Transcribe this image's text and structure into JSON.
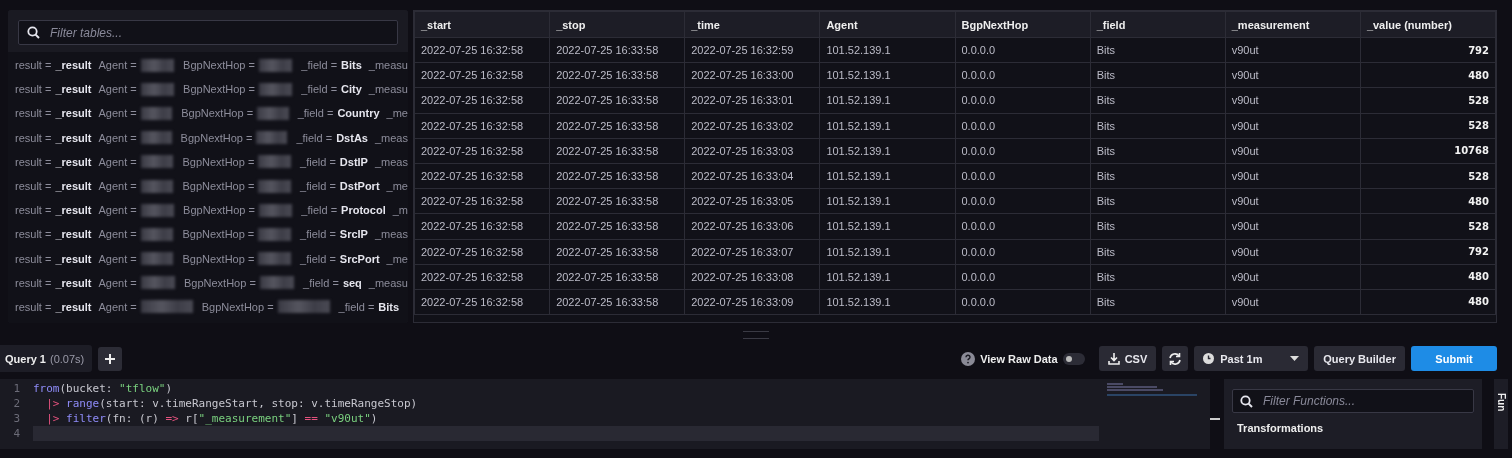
{
  "tables_panel": {
    "filter": {
      "placeholder": "Filter tables..."
    },
    "rows": [
      {
        "pairs": [
          {
            "label": "result =",
            "value": "_result"
          },
          {
            "label": "Agent =",
            "redacted": true
          },
          {
            "label": "BgpNextHop =",
            "redacted": true
          },
          {
            "label": "_field =",
            "value": "Bits"
          },
          {
            "label": "_measu"
          }
        ]
      },
      {
        "pairs": [
          {
            "label": "result =",
            "value": "_result"
          },
          {
            "label": "Agent =",
            "redacted": true
          },
          {
            "label": "BgpNextHop =",
            "redacted": true
          },
          {
            "label": "_field =",
            "value": "City"
          },
          {
            "label": "_measu"
          }
        ]
      },
      {
        "pairs": [
          {
            "label": "result =",
            "value": "_result"
          },
          {
            "label": "Agent =",
            "redacted": true
          },
          {
            "label": "BgpNextHop =",
            "redacted": true
          },
          {
            "label": "_field =",
            "value": "Country"
          },
          {
            "label": "_me"
          }
        ]
      },
      {
        "pairs": [
          {
            "label": "result =",
            "value": "_result"
          },
          {
            "label": "Agent =",
            "redacted": true
          },
          {
            "label": "BgpNextHop =",
            "redacted": true
          },
          {
            "label": "_field =",
            "value": "DstAs"
          },
          {
            "label": "_meas"
          }
        ]
      },
      {
        "pairs": [
          {
            "label": "result =",
            "value": "_result"
          },
          {
            "label": "Agent =",
            "redacted": true
          },
          {
            "label": "BgpNextHop =",
            "redacted": true
          },
          {
            "label": "_field =",
            "value": "DstIP"
          },
          {
            "label": "_meas"
          }
        ]
      },
      {
        "pairs": [
          {
            "label": "result =",
            "value": "_result"
          },
          {
            "label": "Agent =",
            "redacted": true
          },
          {
            "label": "BgpNextHop =",
            "redacted": true
          },
          {
            "label": "_field =",
            "value": "DstPort"
          },
          {
            "label": "_me"
          }
        ]
      },
      {
        "pairs": [
          {
            "label": "result =",
            "value": "_result"
          },
          {
            "label": "Agent =",
            "redacted": true
          },
          {
            "label": "BgpNextHop =",
            "redacted": true
          },
          {
            "label": "_field =",
            "value": "Protocol"
          },
          {
            "label": "_m"
          }
        ]
      },
      {
        "pairs": [
          {
            "label": "result =",
            "value": "_result"
          },
          {
            "label": "Agent =",
            "redacted": true
          },
          {
            "label": "BgpNextHop =",
            "redacted": true
          },
          {
            "label": "_field =",
            "value": "SrcIP"
          },
          {
            "label": "_meas"
          }
        ]
      },
      {
        "pairs": [
          {
            "label": "result =",
            "value": "_result"
          },
          {
            "label": "Agent =",
            "redacted": true
          },
          {
            "label": "BgpNextHop =",
            "redacted": true
          },
          {
            "label": "_field =",
            "value": "SrcPort"
          },
          {
            "label": "_me"
          }
        ]
      },
      {
        "pairs": [
          {
            "label": "result =",
            "value": "_result"
          },
          {
            "label": "Agent =",
            "redacted": true
          },
          {
            "label": "BgpNextHop =",
            "redacted": true
          },
          {
            "label": "_field =",
            "value": "seq"
          },
          {
            "label": "_measu"
          }
        ]
      },
      {
        "pairs": [
          {
            "label": "result =",
            "value": "_result"
          },
          {
            "label": "Agent =",
            "redacted": true
          },
          {
            "label": "BgpNextHop =",
            "redacted": true
          },
          {
            "label": "_field =",
            "value": "Bits"
          }
        ]
      }
    ]
  },
  "table": {
    "columns": [
      "_start",
      "_stop",
      "_time",
      "Agent",
      "BgpNextHop",
      "_field",
      "_measurement",
      "_value (number)"
    ],
    "rows": [
      [
        "2022-07-25 16:32:58",
        "2022-07-25 16:33:58",
        "2022-07-25 16:32:59",
        "101.52.139.1",
        "0.0.0.0",
        "Bits",
        "v90ut",
        "792"
      ],
      [
        "2022-07-25 16:32:58",
        "2022-07-25 16:33:58",
        "2022-07-25 16:33:00",
        "101.52.139.1",
        "0.0.0.0",
        "Bits",
        "v90ut",
        "480"
      ],
      [
        "2022-07-25 16:32:58",
        "2022-07-25 16:33:58",
        "2022-07-25 16:33:01",
        "101.52.139.1",
        "0.0.0.0",
        "Bits",
        "v90ut",
        "528"
      ],
      [
        "2022-07-25 16:32:58",
        "2022-07-25 16:33:58",
        "2022-07-25 16:33:02",
        "101.52.139.1",
        "0.0.0.0",
        "Bits",
        "v90ut",
        "528"
      ],
      [
        "2022-07-25 16:32:58",
        "2022-07-25 16:33:58",
        "2022-07-25 16:33:03",
        "101.52.139.1",
        "0.0.0.0",
        "Bits",
        "v90ut",
        "10768"
      ],
      [
        "2022-07-25 16:32:58",
        "2022-07-25 16:33:58",
        "2022-07-25 16:33:04",
        "101.52.139.1",
        "0.0.0.0",
        "Bits",
        "v90ut",
        "528"
      ],
      [
        "2022-07-25 16:32:58",
        "2022-07-25 16:33:58",
        "2022-07-25 16:33:05",
        "101.52.139.1",
        "0.0.0.0",
        "Bits",
        "v90ut",
        "480"
      ],
      [
        "2022-07-25 16:32:58",
        "2022-07-25 16:33:58",
        "2022-07-25 16:33:06",
        "101.52.139.1",
        "0.0.0.0",
        "Bits",
        "v90ut",
        "528"
      ],
      [
        "2022-07-25 16:32:58",
        "2022-07-25 16:33:58",
        "2022-07-25 16:33:07",
        "101.52.139.1",
        "0.0.0.0",
        "Bits",
        "v90ut",
        "792"
      ],
      [
        "2022-07-25 16:32:58",
        "2022-07-25 16:33:58",
        "2022-07-25 16:33:08",
        "101.52.139.1",
        "0.0.0.0",
        "Bits",
        "v90ut",
        "480"
      ],
      [
        "2022-07-25 16:32:58",
        "2022-07-25 16:33:58",
        "2022-07-25 16:33:09",
        "101.52.139.1",
        "0.0.0.0",
        "Bits",
        "v90ut",
        "480"
      ]
    ]
  },
  "query_bar": {
    "tabs": [
      {
        "label": "Query 1",
        "duration": "(0.07s)",
        "selected": true
      }
    ],
    "raw_data_toggle": {
      "label": "View Raw Data",
      "on": false
    },
    "csv_button": "CSV",
    "time_range": "Past 1m",
    "query_builder_button": "Query Builder",
    "submit_button": "Submit"
  },
  "editor": {
    "lines": [
      {
        "number": "1",
        "active": false,
        "tokens": [
          {
            "kind": "fn",
            "text": "from"
          },
          {
            "kind": "plain",
            "text": "(bucket: "
          },
          {
            "kind": "string",
            "text": "\"tflow\""
          },
          {
            "kind": "plain",
            "text": ")"
          }
        ]
      },
      {
        "number": "2",
        "active": false,
        "tokens": [
          {
            "kind": "op",
            "text": "  |>"
          },
          {
            "kind": "fn",
            "text": " range"
          },
          {
            "kind": "plain",
            "text": "(start: v.timeRangeStart, stop: v.timeRangeStop)"
          }
        ]
      },
      {
        "number": "3",
        "active": false,
        "tokens": [
          {
            "kind": "op",
            "text": "  |>"
          },
          {
            "kind": "fn",
            "text": " filter"
          },
          {
            "kind": "plain",
            "text": "(fn: (r) "
          },
          {
            "kind": "op",
            "text": "=>"
          },
          {
            "kind": "plain",
            "text": " r["
          },
          {
            "kind": "string",
            "text": "\"_measurement\""
          },
          {
            "kind": "plain",
            "text": "] "
          },
          {
            "kind": "op",
            "text": "=="
          },
          {
            "kind": "string",
            "text": " \"v90ut\""
          },
          {
            "kind": "plain",
            "text": ")"
          }
        ]
      },
      {
        "number": "4",
        "active": true
      }
    ]
  },
  "functions_panel": {
    "filter": {
      "placeholder": "Filter Functions..."
    },
    "section": "Transformations",
    "side_tab": "Fun"
  }
}
